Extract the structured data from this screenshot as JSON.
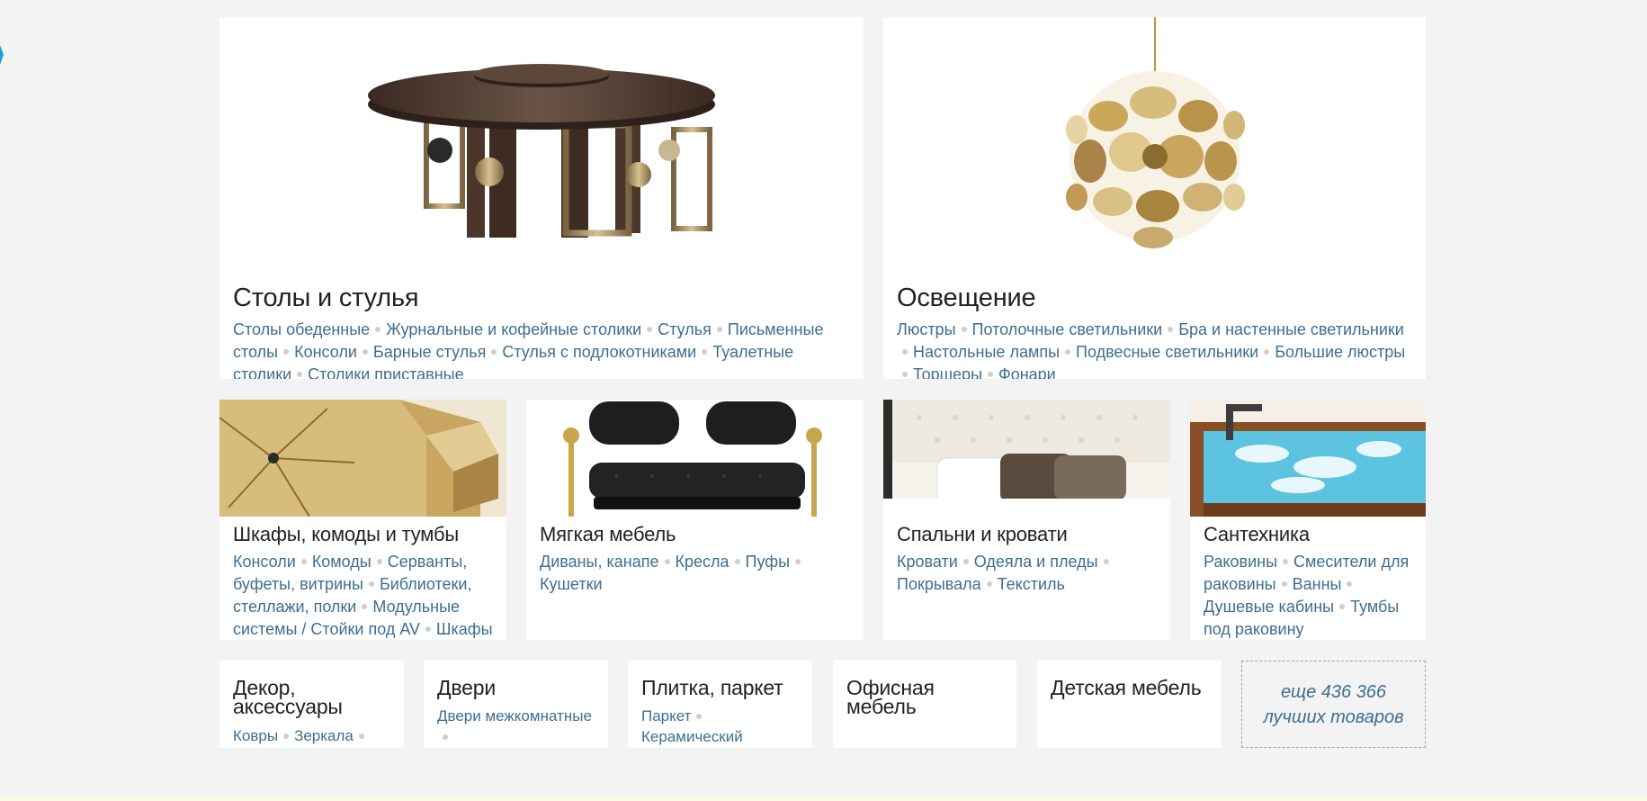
{
  "categories_large": [
    {
      "title": "Столы и стулья",
      "links": [
        "Столы обеденные",
        "Журнальные и кофейные столики",
        "Стулья",
        "Письменные столы",
        "Консоли",
        "Барные стулья",
        "Стулья с подлокотниками",
        "Туалетные столики",
        "Столики приставные"
      ]
    },
    {
      "title": "Освещение",
      "links": [
        "Люстры",
        "Потолочные светильники",
        "Бра и настенные светильники",
        "Настольные лампы",
        "Подвесные светильники",
        "Большие люстры",
        "Торшеры",
        "Фонари"
      ]
    }
  ],
  "categories_medium": [
    {
      "title": "Шкафы, комоды и тумбы",
      "links": [
        "Консоли",
        "Комоды",
        "Серванты, буфеты, витрины",
        "Библиотеки, стеллажи, полки",
        "Модульные системы / Стойки под AV",
        "Шкафы"
      ]
    },
    {
      "title": "Мягкая мебель",
      "links": [
        "Диваны, канапе",
        "Кресла",
        "Пуфы",
        "Кушетки"
      ]
    },
    {
      "title": "Спальни и кровати",
      "links": [
        "Кровати",
        "Одеяла и пледы",
        "Покрывала",
        "Текстиль"
      ]
    },
    {
      "title": "Сантехника",
      "links": [
        "Раковины",
        "Смесители для раковины",
        "Ванны",
        "Душевые кабины",
        "Тумбы под раковину"
      ]
    }
  ],
  "categories_small": [
    {
      "title": "Декор, аксессуары",
      "links": [
        "Ковры",
        "Зеркала"
      ]
    },
    {
      "title": "Двери",
      "links": [
        "Двери межкомнатные"
      ]
    },
    {
      "title": "Плитка, паркет",
      "links": [
        "Паркет",
        "Керамический"
      ]
    },
    {
      "title": "Офисная мебель",
      "links": []
    },
    {
      "title": "Детская мебель",
      "links": []
    }
  ],
  "more": {
    "line1": "еще 436 366",
    "line2": "лучших товаров"
  },
  "colors": {
    "page_bg": "#f3f3f3",
    "link": "#3d6e92",
    "title": "#222222",
    "separator_dot": "#cfcfcf"
  }
}
